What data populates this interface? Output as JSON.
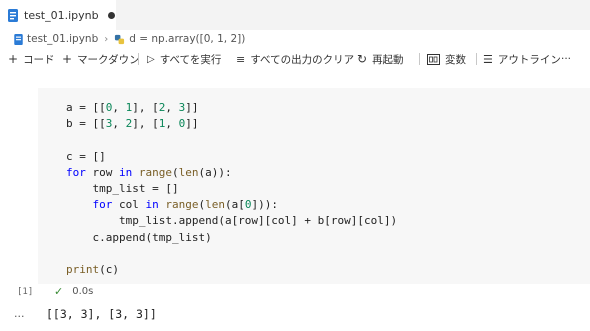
{
  "tab": {
    "filename": "test_01.ipynb"
  },
  "breadcrumb": {
    "file": "test_01.ipynb",
    "cell": "d = np.array([0, 1, 2])"
  },
  "toolbar": {
    "code": "コード",
    "markdown": "マークダウン",
    "run_all": "すべてを実行",
    "clear_outputs": "すべての出力のクリア",
    "restart": "再起動",
    "variables": "変数",
    "outline": "アウトライン",
    "more": "···"
  },
  "cell": {
    "execution_count": "[1]",
    "duration": "0.0s",
    "code_lines": [
      "a = [[0, 1], [2, 3]]",
      "b = [[3, 2], [1, 0]]",
      "",
      "c = []",
      "for row in range(len(a)):",
      "    tmp_list = []",
      "    for col in range(len(a[0])):",
      "        tmp_list.append(a[row][col] + b[row][col])",
      "    c.append(tmp_list)",
      "",
      "print(c)"
    ],
    "output_more": "···",
    "output": "[[3, 3], [3, 3]]"
  }
}
